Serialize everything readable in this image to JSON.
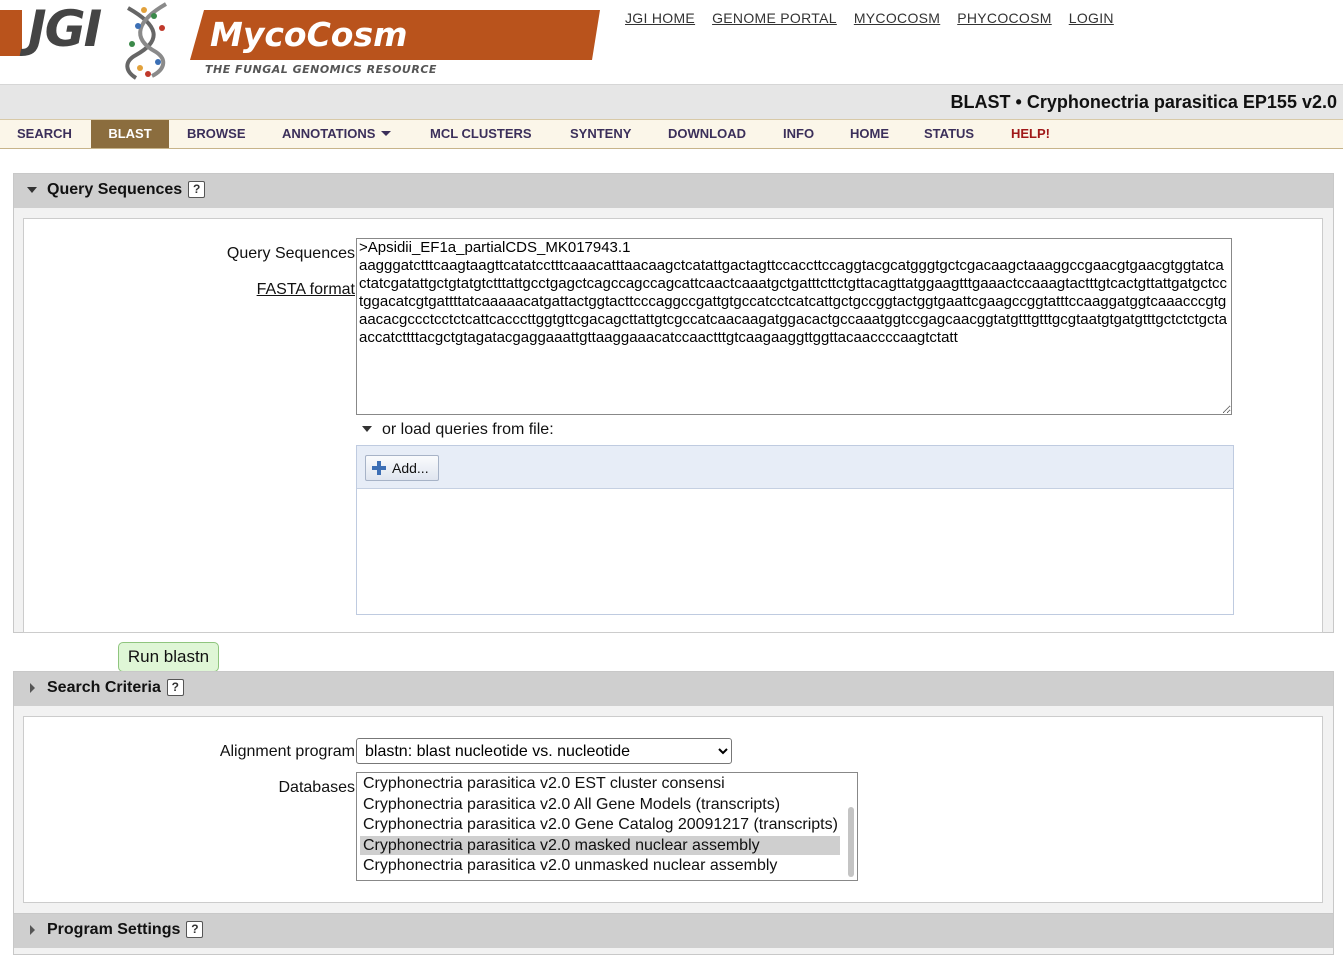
{
  "header": {
    "jgi_logo": "JGI",
    "mycocosm_logo": "MycoCosm",
    "mycocosm_tagline": "THE FUNGAL GENOMICS RESOURCE",
    "links": [
      "JGI HOME",
      "GENOME PORTAL",
      "MYCOCOSM",
      "PHYCOCOSM",
      "LOGIN"
    ]
  },
  "title": "BLAST • Cryphonectria parasitica EP155 v2.0",
  "nav": {
    "items": [
      "SEARCH",
      "BLAST",
      "BROWSE",
      "ANNOTATIONS",
      "MCL CLUSTERS",
      "SYNTENY",
      "DOWNLOAD",
      "INFO",
      "HOME",
      "STATUS",
      "HELP!"
    ],
    "active": "BLAST"
  },
  "query_panel": {
    "title": "Query Sequences",
    "help": "?",
    "field_label": "Query Sequences",
    "fasta_link": "FASTA format",
    "sequence": ">Apsidii_EF1a_partialCDS_MK017943.1\naagggatctttcaagtaagttcatatcctttcaaacatttaacaagctcatattgactagttccaccttccaggtacgcatgggtgctcgacaagctaaaggccgaacgtgaacgtggtatcactatcgatattgctgtatgtctttattgcctgagctcagccagccagcattcaactcaaatgctgatttcttctgttacagttatggaagtttgaaactccaaagtactttgtcactgttattgatgctcctggacatcgtgattttatcaaaaacatgattactggtacttcccaggccgattgtgccatcctcatcattgctgccggtactggtgaattcgaagccggtatttccaaggatggtcaaacccgtgaacacgccctcctctcattcacccttggtgttcgacagcttattgtcgccatcaacaagatggacactgccaaatggtccgagcaacggtatgtttgtttgcgtaatgtgatgtttgctctctgctaaccatcttttacgctgtagatacgaggaaattgttaaggaaacatccaactttgtcaagaaggttggttacaaccccaagtctatt",
    "load_toggle": "or load queries from file:",
    "add_button": "Add..."
  },
  "run_button": "Run blastn",
  "criteria_panel": {
    "title": "Search Criteria",
    "help": "?",
    "program_label": "Alignment program",
    "program_value": "blastn: blast nucleotide vs. nucleotide",
    "databases_label": "Databases",
    "databases": [
      "Cryphonectria parasitica v2.0 EST cluster consensi",
      "Cryphonectria parasitica v2.0 All Gene Models (transcripts)",
      "Cryphonectria parasitica v2.0 Gene Catalog 20091217 (transcripts)",
      "Cryphonectria parasitica v2.0 masked nuclear assembly",
      "Cryphonectria parasitica v2.0 unmasked nuclear assembly"
    ],
    "selected_database": "Cryphonectria parasitica v2.0 masked nuclear assembly"
  },
  "settings_panel": {
    "title": "Program Settings",
    "help": "?"
  },
  "colors": {
    "brand_orange": "#b9531c",
    "nav_active": "#8b6d3e",
    "nav_text": "#3b2f5a",
    "help_red": "#a01818",
    "run_button_bg": "#dff6d6"
  }
}
